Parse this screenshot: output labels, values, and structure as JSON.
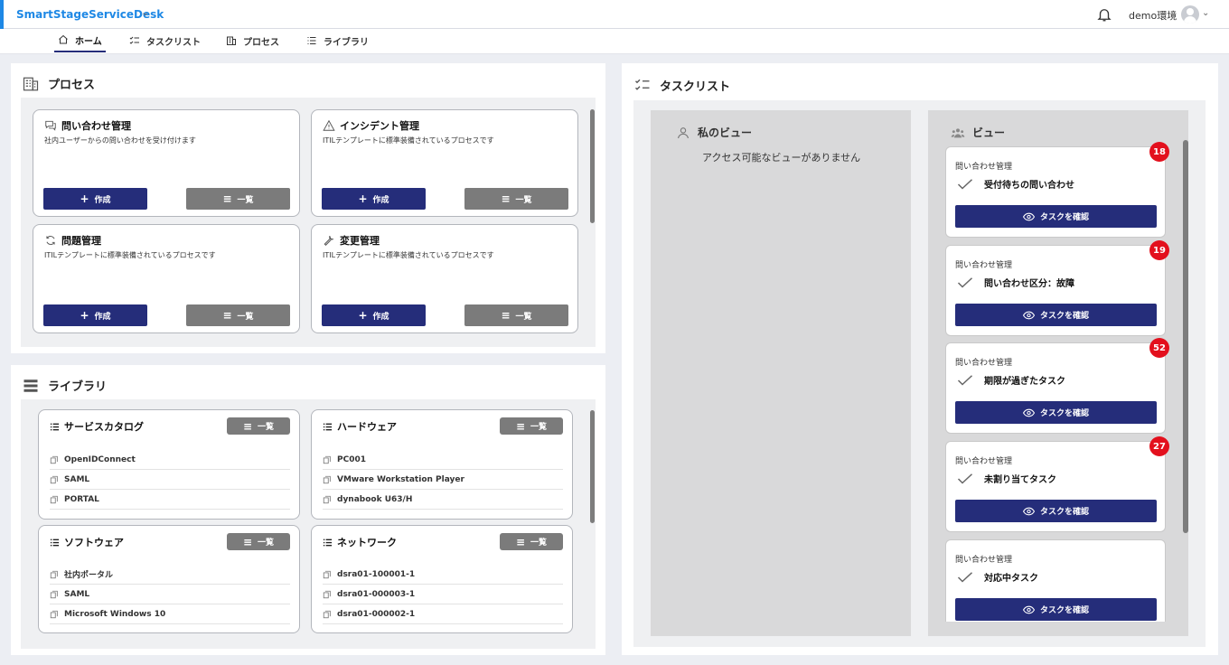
{
  "header": {
    "brand": "SmartStageServiceDesk",
    "env_name": "demo環境"
  },
  "nav": {
    "tabs": [
      {
        "label": "ホーム",
        "icon": "home-icon",
        "active": true
      },
      {
        "label": "タスクリスト",
        "icon": "checklist-icon"
      },
      {
        "label": "プロセス",
        "icon": "building-icon"
      },
      {
        "label": "ライブラリ",
        "icon": "list-icon"
      }
    ]
  },
  "process": {
    "title": "プロセス",
    "cards": [
      {
        "name": "問い合わせ管理",
        "icon": "chat-icon",
        "desc": "社内ユーザーからの問い合わせを受け付けます",
        "create": "作成",
        "list": "一覧"
      },
      {
        "name": "インシデント管理",
        "icon": "warning-icon",
        "desc": "ITILテンプレートに標準装備されているプロセスです",
        "create": "作成",
        "list": "一覧"
      },
      {
        "name": "問題管理",
        "icon": "refresh-icon",
        "desc": "ITILテンプレートに標準装備されているプロセスです",
        "create": "作成",
        "list": "一覧"
      },
      {
        "name": "変更管理",
        "icon": "wrench-icon",
        "desc": "ITILテンプレートに標準装備されているプロセスです",
        "create": "作成",
        "list": "一覧"
      }
    ]
  },
  "library": {
    "title": "ライブラリ",
    "cards": [
      {
        "name": "サービスカタログ",
        "list": "一覧",
        "items": [
          "OpenIDConnect",
          "SAML",
          "PORTAL"
        ]
      },
      {
        "name": "ハードウェア",
        "list": "一覧",
        "items": [
          "PC001",
          "VMware Workstation Player",
          "dynabook U63/H"
        ]
      },
      {
        "name": "ソフトウェア",
        "list": "一覧",
        "items": [
          "社内ポータル",
          "SAML",
          "Microsoft Windows 10"
        ]
      },
      {
        "name": "ネットワーク",
        "list": "一覧",
        "items": [
          "dsra01-100001-1",
          "dsra01-000003-1",
          "dsra01-000002-1"
        ]
      }
    ]
  },
  "tasklist": {
    "title": "タスクリスト",
    "my_view": {
      "title": "私のビュー",
      "empty": "アクセス可能なビューがありません"
    },
    "views": {
      "title": "ビュー",
      "items": [
        {
          "process": "問い合わせ管理",
          "name": "受付待ちの問い合わせ",
          "count": "18",
          "button": "タスクを確認"
        },
        {
          "process": "問い合わせ管理",
          "name": "問い合わせ区分：故障",
          "count": "19",
          "button": "タスクを確認"
        },
        {
          "process": "問い合わせ管理",
          "name": "期限が過ぎたタスク",
          "count": "52",
          "button": "タスクを確認"
        },
        {
          "process": "問い合わせ管理",
          "name": "未割り当てタスク",
          "count": "27",
          "button": "タスクを確認"
        },
        {
          "process": "問い合わせ管理",
          "name": "対応中タスク",
          "count": "",
          "button": "タスクを確認"
        }
      ]
    }
  }
}
